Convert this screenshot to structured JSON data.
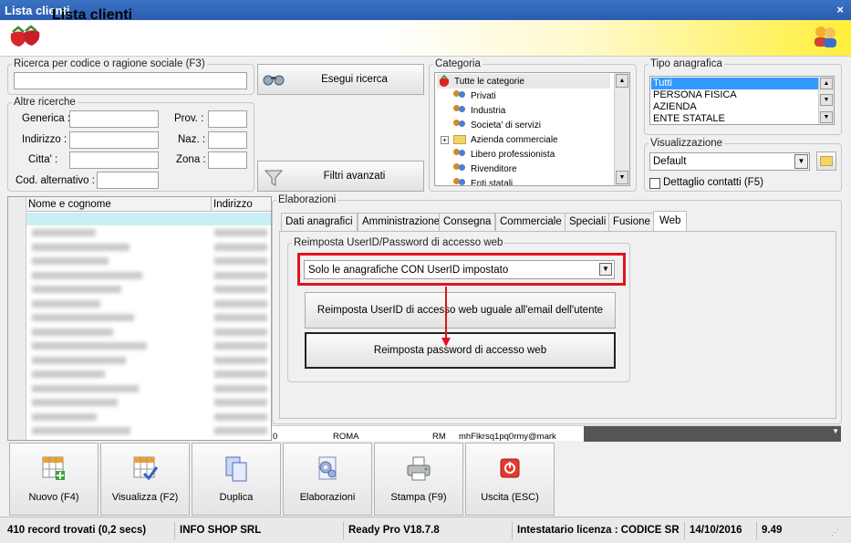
{
  "window": {
    "title": "Lista clienti",
    "close_glyph": "×"
  },
  "header": {
    "title": "Lista clienti"
  },
  "search": {
    "codice_legend": "Ricerca per codice o ragione sociale (F3)",
    "codice_value": "",
    "esegui_label": "Esegui ricerca",
    "altre_legend": "Altre ricerche",
    "fields": [
      {
        "label": "Generica :",
        "value": ""
      },
      {
        "label": "Indirizzo :",
        "value": ""
      },
      {
        "label": "Citta' :",
        "value": ""
      },
      {
        "label": "Cod. alternativo :",
        "value": ""
      }
    ],
    "right_fields": [
      {
        "label": "Prov. :",
        "value": ""
      },
      {
        "label": "Naz. :",
        "value": ""
      },
      {
        "label": "Zona :",
        "value": ""
      }
    ],
    "filtri_label": "Filtri avanzati"
  },
  "categoria": {
    "legend": "Categoria",
    "items": [
      "Tutte le categorie",
      "Privati",
      "Industria",
      "Societa' di servizi",
      "Azienda commerciale",
      "Libero professionista",
      "Rivenditore",
      "Enti statali"
    ],
    "expand_glyph": "+"
  },
  "tipo": {
    "legend": "Tipo anagrafica",
    "items": [
      "Tutti",
      "PERSONA FISICA",
      "AZIENDA",
      "ENTE STATALE"
    ]
  },
  "visualizzazione": {
    "legend": "Visualizzazione",
    "value": "Default",
    "dettaglio_label": "Dettaglio contatti (F5)",
    "dettaglio_checked": false
  },
  "grid": {
    "columns": [
      "Nome e cognome",
      "Indirizzo"
    ],
    "bottom_row": [
      "0",
      "ROMA",
      "RM",
      "mhFlkrsq1pq0rmy@mark"
    ]
  },
  "elaborazioni": {
    "legend": "Elaborazioni",
    "tabs": [
      "Dati anagrafici",
      "Amministrazione",
      "Consegna",
      "Commerciale",
      "Speciali",
      "Fusione",
      "Web"
    ],
    "active_tab": "Web",
    "web_group_legend": "Reimposta UserID/Password di accesso web",
    "filter_value": "Solo le anagrafiche CON UserID impostato",
    "btn_userid": "Reimposta UserID di accesso web uguale all'email dell'utente",
    "btn_password": "Reimposta password di accesso web",
    "highlight_color": "#e0141e"
  },
  "actions": [
    {
      "label": "Nuovo (F4)",
      "icon": "new-grid-icon"
    },
    {
      "label": "Visualizza (F2)",
      "icon": "view-grid-icon"
    },
    {
      "label": "Duplica",
      "icon": "duplicate-icon"
    },
    {
      "label": "Elaborazioni",
      "icon": "gear-document-icon"
    },
    {
      "label": "Stampa (F9)",
      "icon": "printer-icon"
    },
    {
      "label": "Uscita (ESC)",
      "icon": "power-icon"
    }
  ],
  "statusbar": {
    "records": "410 record trovati (0,2 secs)",
    "company": "INFO SHOP SRL",
    "version": "Ready Pro V18.7.8",
    "license": "Intestatario licenza : CODICE SR",
    "date": "14/10/2016",
    "time": "9.49"
  }
}
